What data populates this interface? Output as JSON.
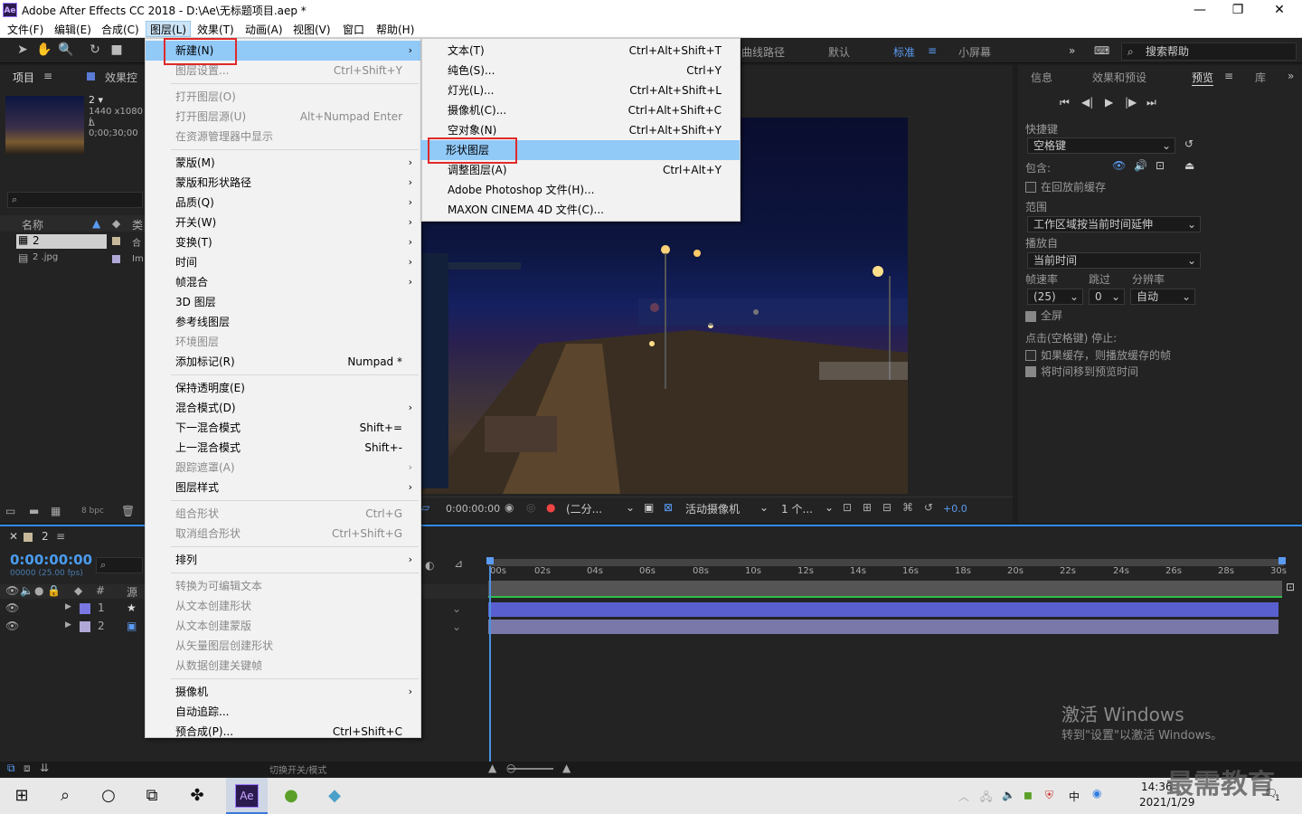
{
  "window": {
    "app_icon": "Ae",
    "title": "Adobe After Effects CC 2018 - D:\\Ae\\无标题项目.aep *",
    "minimize": "—",
    "restore": "❐",
    "close": "✕"
  },
  "menubar": [
    "文件(F)",
    "编辑(E)",
    "合成(C)",
    "图层(L)",
    "效果(T)",
    "动画(A)",
    "视图(V)",
    "窗口",
    "帮助(H)"
  ],
  "workspaces": [
    "曲线路径",
    "默认",
    "标准",
    "小屏幕"
  ],
  "active_workspace": "标准",
  "search_help": "搜索帮助",
  "project_panel": {
    "tab_project": "项目",
    "tab_effects": "效果控",
    "item_name": "2 ▾",
    "item_info1": "1440 x1080 (",
    "item_info2": "Δ 0;00;30;00",
    "col_name": "名称",
    "col_type": "类",
    "rows": [
      {
        "name": "2",
        "type": "合"
      },
      {
        "name": "2 .jpg",
        "type": "Im"
      }
    ],
    "bpc": "8 bpc"
  },
  "layer_menu": {
    "items": [
      {
        "label": "新建(N)",
        "shortcut": "",
        "arrow": true,
        "disabled": false
      },
      {
        "label": "图层设置...",
        "shortcut": "Ctrl+Shift+Y",
        "arrow": false,
        "disabled": true
      },
      {
        "label": "打开图层(O)",
        "shortcut": "",
        "arrow": false,
        "disabled": true
      },
      {
        "label": "打开图层源(U)",
        "shortcut": "Alt+Numpad Enter",
        "arrow": false,
        "disabled": true
      },
      {
        "label": "在资源管理器中显示",
        "shortcut": "",
        "arrow": false,
        "disabled": true
      },
      {
        "label": "蒙版(M)",
        "shortcut": "",
        "arrow": true,
        "disabled": false
      },
      {
        "label": "蒙版和形状路径",
        "shortcut": "",
        "arrow": true,
        "disabled": false
      },
      {
        "label": "品质(Q)",
        "shortcut": "",
        "arrow": true,
        "disabled": false
      },
      {
        "label": "开关(W)",
        "shortcut": "",
        "arrow": true,
        "disabled": false
      },
      {
        "label": "变换(T)",
        "shortcut": "",
        "arrow": true,
        "disabled": false
      },
      {
        "label": "时间",
        "shortcut": "",
        "arrow": true,
        "disabled": false
      },
      {
        "label": "帧混合",
        "shortcut": "",
        "arrow": true,
        "disabled": false
      },
      {
        "label": "3D 图层",
        "shortcut": "",
        "arrow": false,
        "disabled": false
      },
      {
        "label": "参考线图层",
        "shortcut": "",
        "arrow": false,
        "disabled": false
      },
      {
        "label": "环境图层",
        "shortcut": "",
        "arrow": false,
        "disabled": true
      },
      {
        "label": "添加标记(R)",
        "shortcut": "Numpad *",
        "arrow": false,
        "disabled": false
      },
      {
        "label": "保持透明度(E)",
        "shortcut": "",
        "arrow": false,
        "disabled": false
      },
      {
        "label": "混合模式(D)",
        "shortcut": "",
        "arrow": true,
        "disabled": false
      },
      {
        "label": "下一混合模式",
        "shortcut": "Shift+=",
        "arrow": false,
        "disabled": false
      },
      {
        "label": "上一混合模式",
        "shortcut": "Shift+-",
        "arrow": false,
        "disabled": false
      },
      {
        "label": "跟踪遮罩(A)",
        "shortcut": "",
        "arrow": true,
        "disabled": true
      },
      {
        "label": "图层样式",
        "shortcut": "",
        "arrow": true,
        "disabled": false
      },
      {
        "label": "组合形状",
        "shortcut": "Ctrl+G",
        "arrow": false,
        "disabled": true
      },
      {
        "label": "取消组合形状",
        "shortcut": "Ctrl+Shift+G",
        "arrow": false,
        "disabled": true
      },
      {
        "label": "排列",
        "shortcut": "",
        "arrow": true,
        "disabled": false
      },
      {
        "label": "转换为可编辑文本",
        "shortcut": "",
        "arrow": false,
        "disabled": true
      },
      {
        "label": "从文本创建形状",
        "shortcut": "",
        "arrow": false,
        "disabled": true
      },
      {
        "label": "从文本创建蒙版",
        "shortcut": "",
        "arrow": false,
        "disabled": true
      },
      {
        "label": "从矢量图层创建形状",
        "shortcut": "",
        "arrow": false,
        "disabled": true
      },
      {
        "label": "从数据创建关键帧",
        "shortcut": "",
        "arrow": false,
        "disabled": true
      },
      {
        "label": "摄像机",
        "shortcut": "",
        "arrow": true,
        "disabled": false
      },
      {
        "label": "自动追踪...",
        "shortcut": "",
        "arrow": false,
        "disabled": false
      },
      {
        "label": "预合成(P)...",
        "shortcut": "Ctrl+Shift+C",
        "arrow": false,
        "disabled": false
      }
    ]
  },
  "new_submenu": {
    "items": [
      {
        "label": "文本(T)",
        "shortcut": "Ctrl+Alt+Shift+T"
      },
      {
        "label": "纯色(S)...",
        "shortcut": "Ctrl+Y"
      },
      {
        "label": "灯光(L)...",
        "shortcut": "Ctrl+Alt+Shift+L"
      },
      {
        "label": "摄像机(C)...",
        "shortcut": "Ctrl+Alt+Shift+C"
      },
      {
        "label": "空对象(N)",
        "shortcut": "Ctrl+Alt+Shift+Y"
      },
      {
        "label": "形状图层",
        "shortcut": ""
      },
      {
        "label": "调整图层(A)",
        "shortcut": "Ctrl+Alt+Y"
      },
      {
        "label": "Adobe Photoshop 文件(H)...",
        "shortcut": ""
      },
      {
        "label": "MAXON CINEMA 4D 文件(C)...",
        "shortcut": ""
      }
    ]
  },
  "comp_viewer": {
    "time": "0:00:00:00",
    "resolution": "(二分...",
    "camera": "活动摄像机",
    "views": "1 个...",
    "exposure": "+0.0"
  },
  "right_panel": {
    "tabs": [
      "信息",
      "效果和预设",
      "预览",
      "库"
    ],
    "active_tab": "预览",
    "shortcut_label": "快捷键",
    "shortcut_value": "空格键",
    "include_label": "包含:",
    "cache_label": "在回放前缓存",
    "range_label": "范围",
    "range_value": "工作区域按当前时间延伸",
    "play_from_label": "播放自",
    "play_from_value": "当前时间",
    "fps_label": "帧速率",
    "skip_label": "跳过",
    "res_label": "分辨率",
    "fps_value": "(25)",
    "skip_value": "0",
    "res_value": "自动",
    "fullscreen_label": "全屏",
    "stop_label": "点击(空格键) 停止:",
    "if_cached_label": "如果缓存，则播放缓存的帧",
    "move_time_label": "将时间移到预览时间"
  },
  "timeline": {
    "comp_tab": "2",
    "timecode": "0:00:00:00",
    "frame_info": "00000 (25.00 fps)",
    "ticks": [
      "00s",
      "02s",
      "04s",
      "06s",
      "08s",
      "10s",
      "12s",
      "14s",
      "16s",
      "18s",
      "20s",
      "22s",
      "24s",
      "26s",
      "28s",
      "30s"
    ],
    "col_num": "#",
    "col_source": "源",
    "layers": [
      {
        "num": "1",
        "icon": "★"
      },
      {
        "num": "2",
        "icon": "▣"
      }
    ],
    "toggle_label": "切换开关/模式"
  },
  "watermark": {
    "line1": "激活 Windows",
    "line2": "转到\"设置\"以激活 Windows。",
    "brand": "最需教育"
  },
  "taskbar": {
    "time": "14:36",
    "date": "2021/1/29",
    "ime": "中",
    "notification_count": "1"
  }
}
